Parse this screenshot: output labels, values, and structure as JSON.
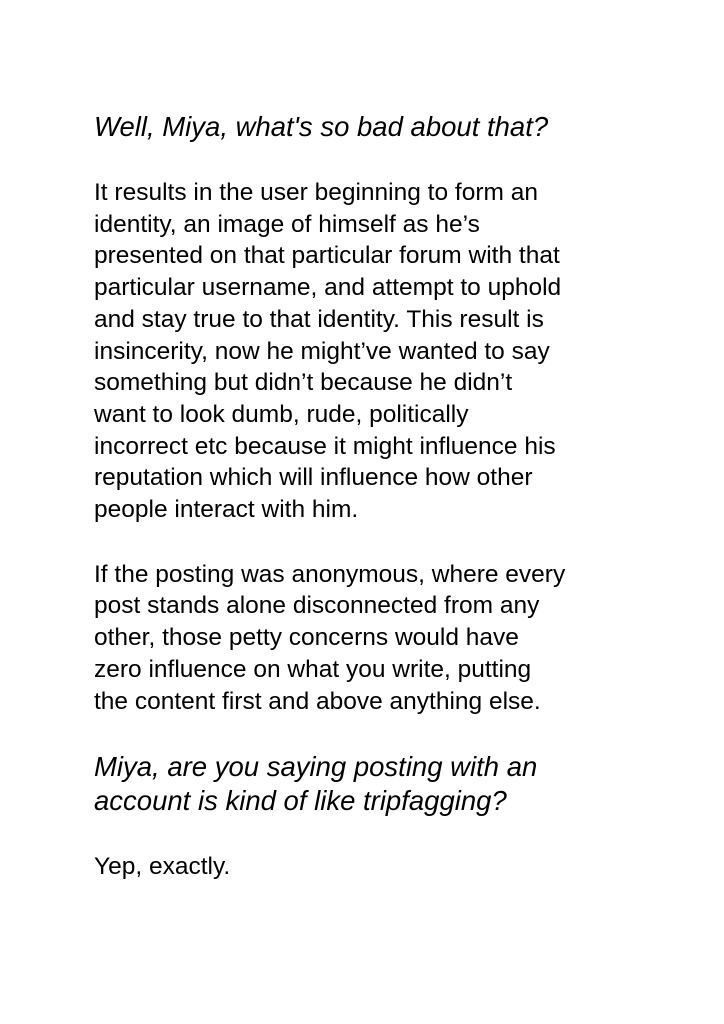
{
  "document": {
    "blocks": [
      {
        "type": "question",
        "lines": [
          "Well, Miya, what's so bad about that?"
        ]
      },
      {
        "type": "answer",
        "lines": [
          "It results in the user beginning to form an",
          "identity, an image of himself as he’s",
          "presented on that particular forum with that",
          "particular username, and attempt to uphold",
          "and stay true to that identity. This result is",
          "insincerity, now he might’ve wanted to say",
          "something but didn’t because he didn’t",
          "want to look dumb, rude, politically",
          "incorrect etc because it might influence his",
          "reputation which will influence how other",
          "people interact with him."
        ]
      },
      {
        "type": "answer",
        "lines": [
          "If the posting was anonymous, where every",
          "post stands alone disconnected from any",
          "other, those petty concerns would have",
          "zero influence on what you write, putting",
          "the content first and above anything else."
        ]
      },
      {
        "type": "question",
        "lines": [
          "Miya, are you saying posting with an",
          "account is kind of like tripfagging?"
        ]
      },
      {
        "type": "answer",
        "lines": [
          "Yep, exactly."
        ]
      }
    ]
  }
}
